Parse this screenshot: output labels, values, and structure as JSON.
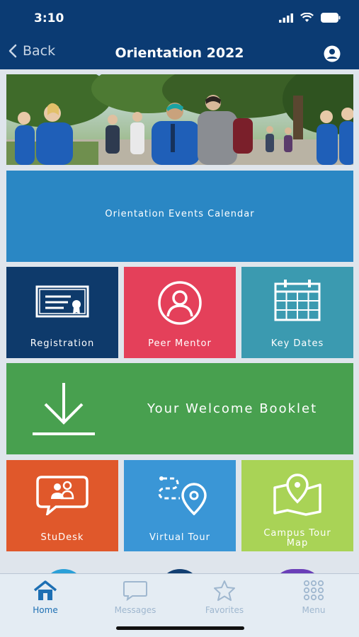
{
  "status_bar": {
    "time": "3:10",
    "icons": [
      "signal-icon",
      "wifi-icon",
      "battery-icon"
    ]
  },
  "nav": {
    "back_label": "Back",
    "title": "Orientation 2022",
    "profile_icon": "user-circle-icon"
  },
  "tiles": {
    "calendar": "Orientation Events Calendar",
    "registration": "Registration",
    "peer_mentor": "Peer Mentor",
    "key_dates": "Key Dates",
    "booklet": "Your Welcome Booklet",
    "studesk": "StuDesk",
    "virtual_tour": "Virtual Tour",
    "campus_tour_map": "Campus Tour Map"
  },
  "tabbar": {
    "home": "Home",
    "messages": "Messages",
    "favorites": "Favorites",
    "menu": "Menu"
  },
  "colors": {
    "nav": "#0b3b73",
    "calendar": "#2a87c4",
    "registration": "#0e3a6b",
    "peer_mentor": "#e4405a",
    "key_dates": "#3b9ab0",
    "booklet": "#48a04f",
    "studesk": "#e0582b",
    "virtual_tour": "#3a96d6",
    "campus_tour_map": "#a9d356",
    "tab_active": "#1d6fb3",
    "tab_inactive": "#9fb7cf"
  }
}
